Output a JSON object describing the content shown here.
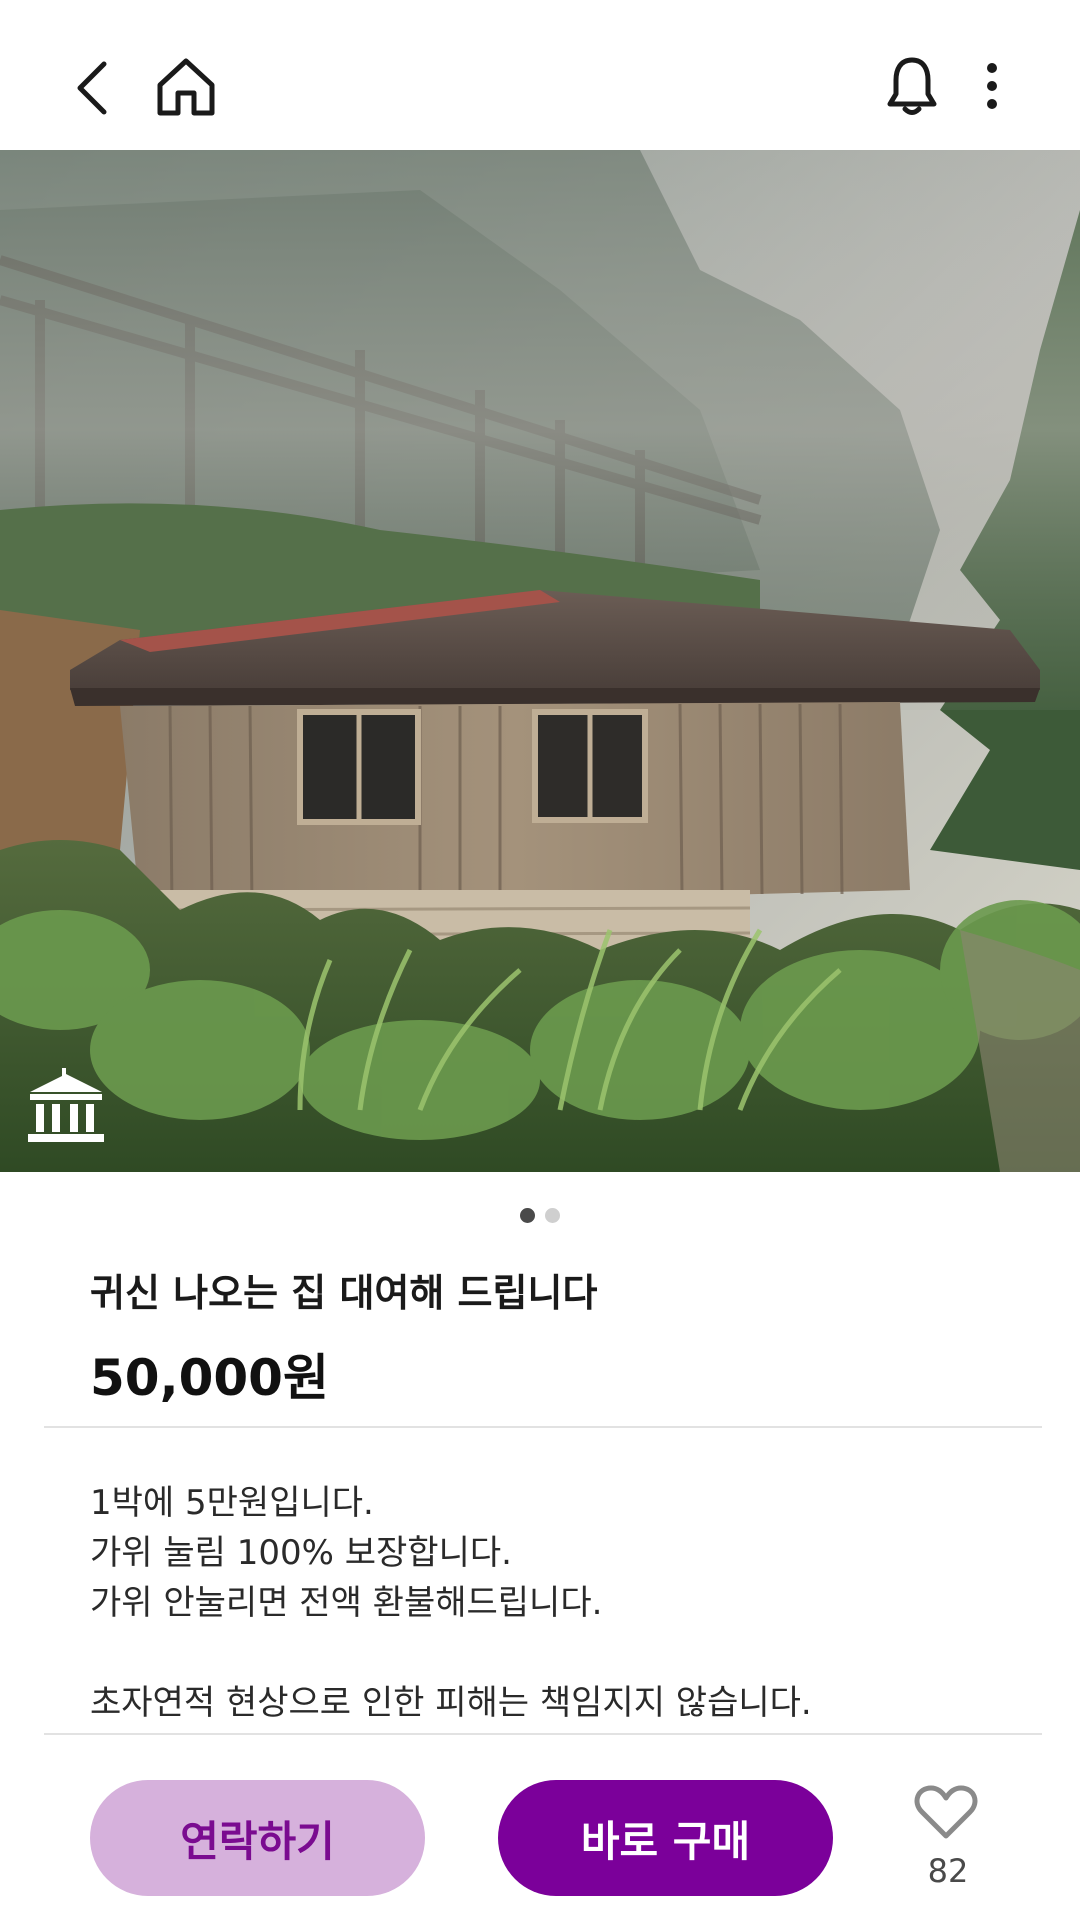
{
  "topbar": {
    "back_icon": "chevron-left-icon",
    "home_icon": "home-icon",
    "notification_icon": "bell-icon",
    "more_icon": "more-vertical-icon"
  },
  "hero": {
    "badge_icon": "museum-icon",
    "page_count": 2,
    "current_page": 1
  },
  "product": {
    "title": "귀신 나오는 집 대여해 드립니다",
    "price": "50,000원"
  },
  "description": {
    "lines": [
      "1박에 5만원입니다.",
      "가위 눌림 100% 보장합니다.",
      "가위 안눌리면 전액 환불해드립니다.",
      "",
      "초자연적 현상으로 인한 피해는 책임지지 않습니다."
    ]
  },
  "actions": {
    "contact_label": "연락하기",
    "buy_label": "바로 구매",
    "like_icon": "heart-icon",
    "like_count": "82"
  },
  "colors": {
    "accent": "#7b009a",
    "accent_light": "#d6b1dc",
    "accent_text": "#7a0b90"
  }
}
